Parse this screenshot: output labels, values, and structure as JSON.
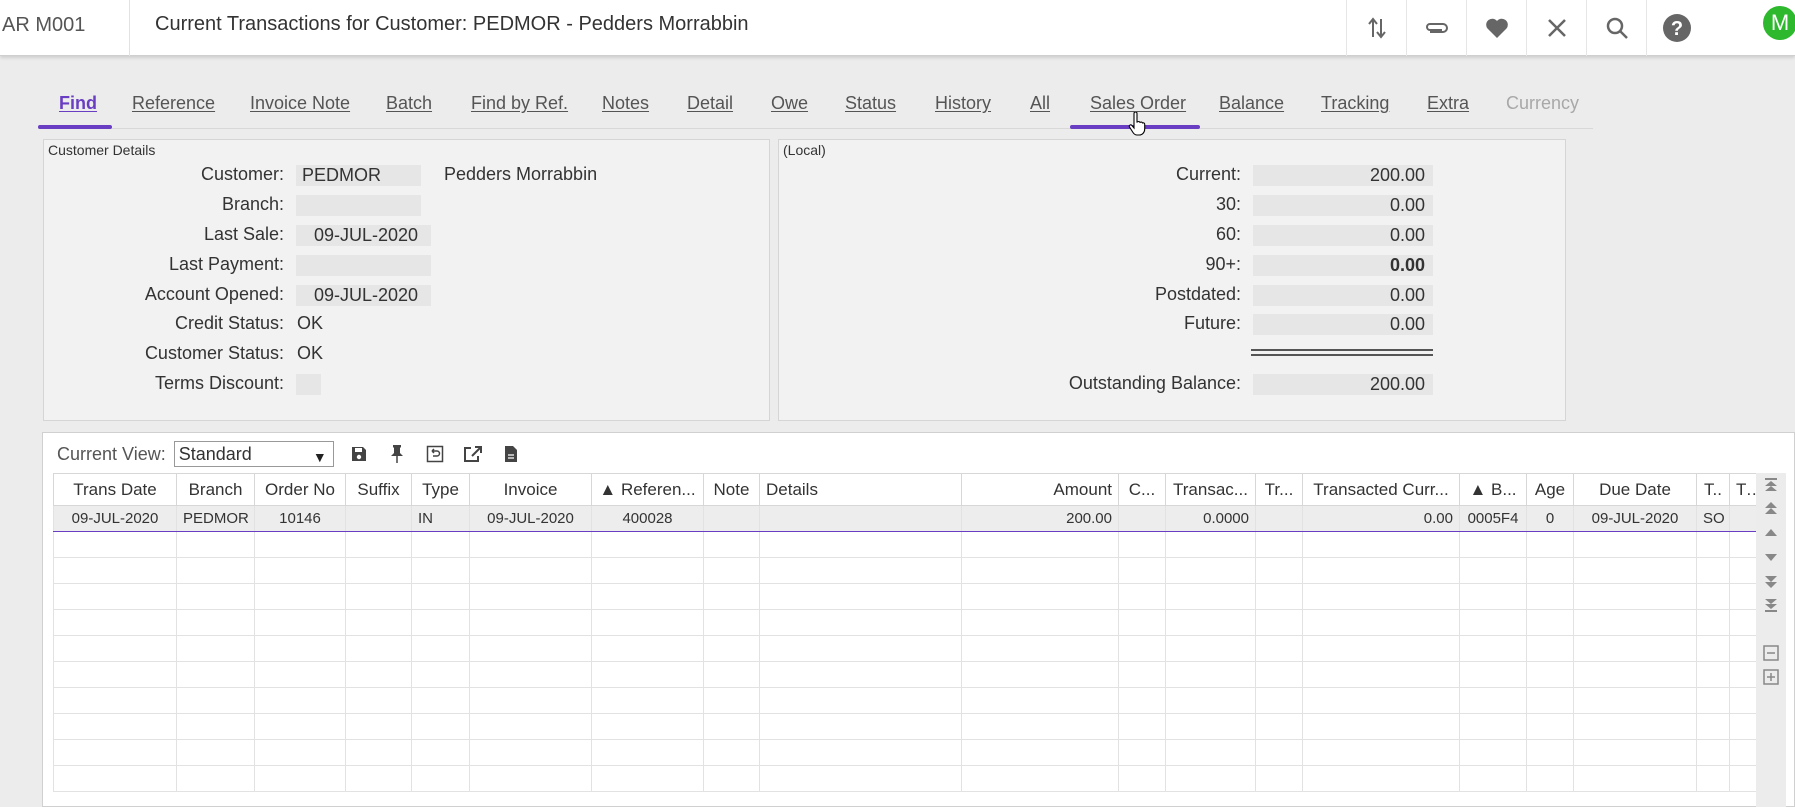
{
  "header": {
    "app_code": "AR M001",
    "title": "Current Transactions for Customer: PEDMOR - Pedders Morrabbin",
    "avatar_letter": "M",
    "icons": [
      "sort-arrows-icon",
      "paperclip-icon",
      "heart-icon",
      "close-icon",
      "search-icon",
      "help-icon"
    ]
  },
  "tabs": [
    {
      "label": "Find",
      "state": "active"
    },
    {
      "label": "Reference",
      "state": "normal"
    },
    {
      "label": "Invoice Note",
      "state": "normal"
    },
    {
      "label": "Batch",
      "state": "normal"
    },
    {
      "label": "Find by Ref.",
      "state": "normal"
    },
    {
      "label": "Notes",
      "state": "normal"
    },
    {
      "label": "Detail",
      "state": "normal"
    },
    {
      "label": "Owe",
      "state": "normal"
    },
    {
      "label": "Status",
      "state": "normal"
    },
    {
      "label": "History",
      "state": "normal"
    },
    {
      "label": "All",
      "state": "normal"
    },
    {
      "label": "Sales Order",
      "state": "hover"
    },
    {
      "label": "Balance",
      "state": "normal"
    },
    {
      "label": "Tracking",
      "state": "normal"
    },
    {
      "label": "Extra",
      "state": "normal"
    },
    {
      "label": "Currency",
      "state": "disabled"
    }
  ],
  "customer_details": {
    "legend": "Customer Details",
    "customer_label": "Customer:",
    "customer_code": "PEDMOR",
    "customer_name": "Pedders Morrabbin",
    "branch_label": "Branch:",
    "branch": "",
    "last_sale_label": "Last Sale:",
    "last_sale": "09-JUL-2020",
    "last_payment_label": "Last Payment:",
    "last_payment": "",
    "account_opened_label": "Account Opened:",
    "account_opened": "09-JUL-2020",
    "credit_status_label": "Credit Status:",
    "credit_status": "OK",
    "customer_status_label": "Customer Status:",
    "customer_status": "OK",
    "terms_discount_label": "Terms Discount:",
    "terms_discount": ""
  },
  "balances": {
    "legend": "(Local)",
    "current_label": "Current:",
    "current": "200.00",
    "d30_label": "30:",
    "d30": "0.00",
    "d60_label": "60:",
    "d60": "0.00",
    "d90_label": "90+:",
    "d90": "0.00",
    "postdated_label": "Postdated:",
    "postdated": "0.00",
    "future_label": "Future:",
    "future": "0.00",
    "outstanding_label": "Outstanding Balance:",
    "outstanding": "200.00"
  },
  "grid": {
    "view_label": "Current View:",
    "view_value": "Standard",
    "toolbar_icons": [
      "save-icon",
      "pin-icon",
      "restore-icon",
      "export-icon",
      "document-icon"
    ],
    "columns": [
      "Trans Date",
      "Branch",
      "Order No",
      "Suffix",
      "Type",
      "Invoice",
      "▲ Referen...",
      "Note",
      "Details",
      "Amount",
      "C...",
      "Transac...",
      "Tr...",
      "Transacted Curr...",
      "▲ B...",
      "Age",
      "Due Date",
      "T..",
      "Tra"
    ],
    "rows": [
      [
        "09-JUL-2020",
        "PEDMOR",
        "10146",
        "",
        "IN",
        "09-JUL-2020",
        "400028",
        "",
        "",
        "200.00",
        "",
        "0.0000",
        "",
        "0.00",
        "0005F4",
        "0",
        "09-JUL-2020",
        "SO",
        ""
      ]
    ]
  }
}
